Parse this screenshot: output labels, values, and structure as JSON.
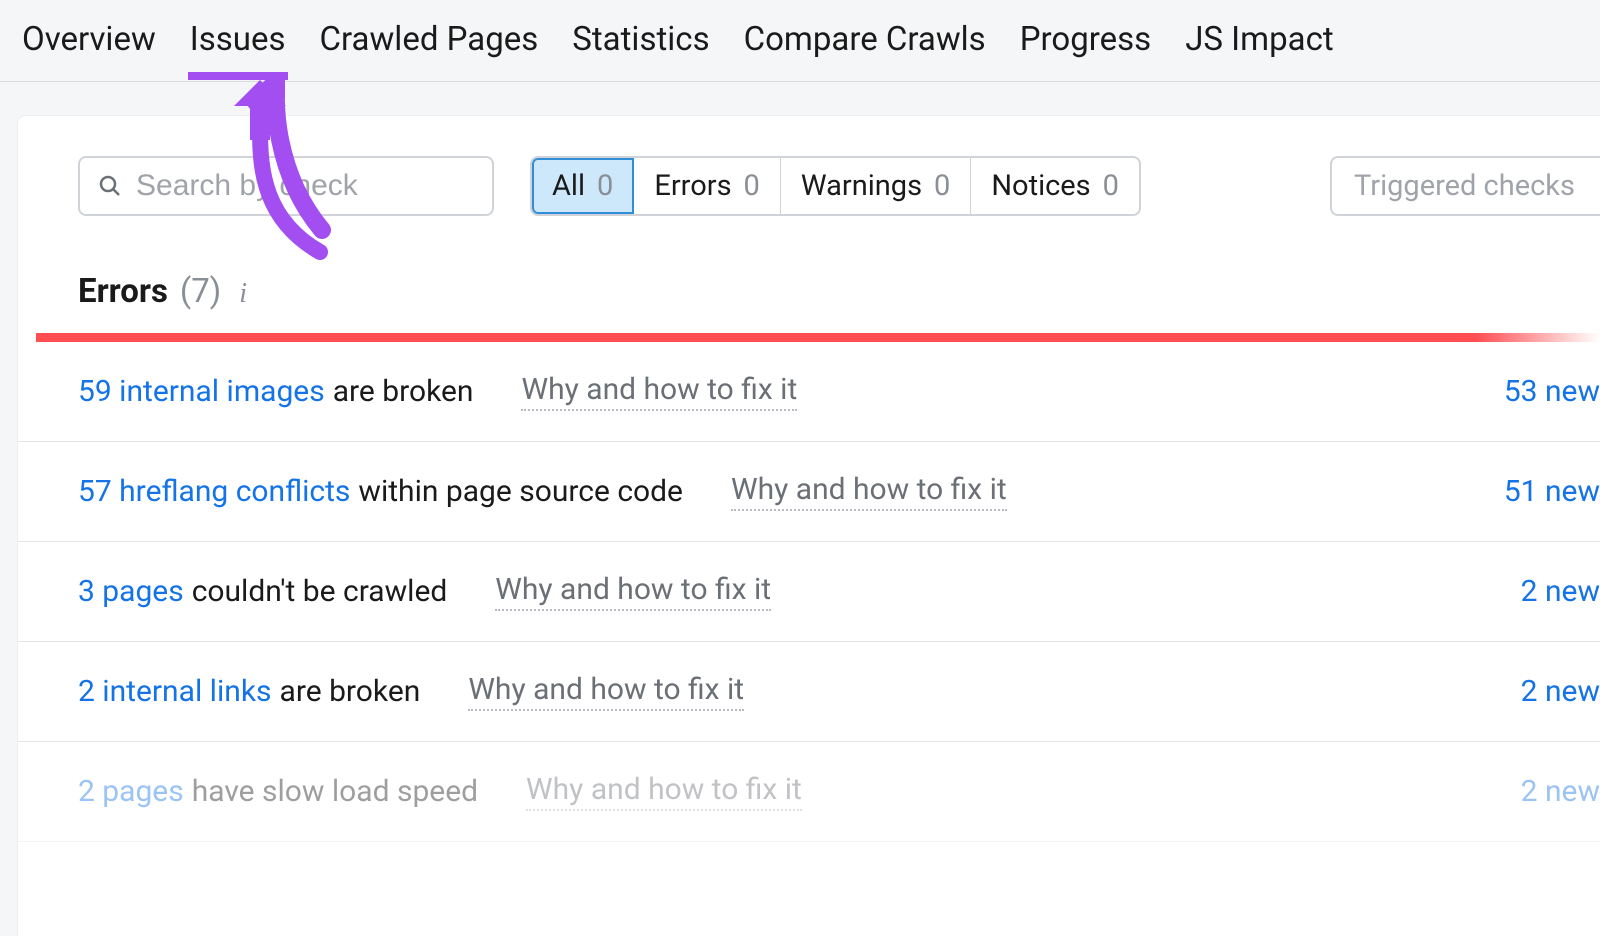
{
  "tabs": [
    {
      "label": "Overview",
      "active": false
    },
    {
      "label": "Issues",
      "active": true
    },
    {
      "label": "Crawled Pages",
      "active": false
    },
    {
      "label": "Statistics",
      "active": false
    },
    {
      "label": "Compare Crawls",
      "active": false
    },
    {
      "label": "Progress",
      "active": false
    },
    {
      "label": "JS Impact",
      "active": false
    }
  ],
  "search": {
    "placeholder": "Search by check",
    "value": ""
  },
  "filters": [
    {
      "label": "All",
      "count": "0",
      "active": true
    },
    {
      "label": "Errors",
      "count": "0",
      "active": false
    },
    {
      "label": "Warnings",
      "count": "0",
      "active": false
    },
    {
      "label": "Notices",
      "count": "0",
      "active": false
    }
  ],
  "triggered_label": "Triggered checks",
  "section": {
    "title": "Errors",
    "count": "(7)"
  },
  "fix_label": "Why and how to fix it",
  "issues": [
    {
      "link": "59 internal images",
      "rest": "are broken",
      "new": "53 new",
      "faded": false
    },
    {
      "link": "57 hreflang conflicts",
      "rest": "within page source code",
      "new": "51 new",
      "faded": false
    },
    {
      "link": "3 pages",
      "rest": "couldn't be crawled",
      "new": "2 new",
      "faded": false
    },
    {
      "link": "2 internal links",
      "rest": "are broken",
      "new": "2 new",
      "faded": false
    },
    {
      "link": "2 pages",
      "rest": "have slow load speed",
      "new": "2 new",
      "faded": true
    }
  ]
}
